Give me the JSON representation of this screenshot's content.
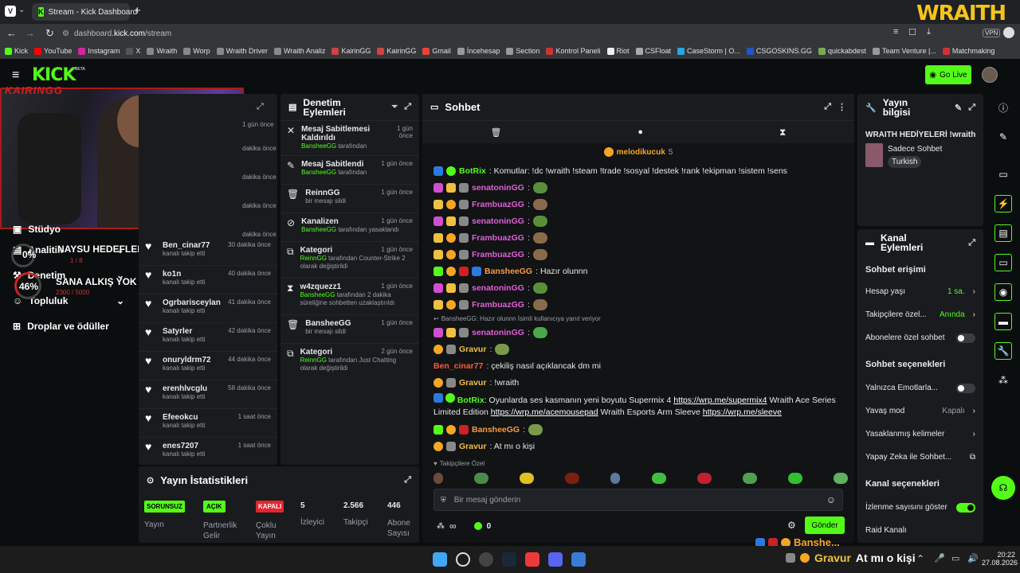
{
  "browser": {
    "tab_title": "Stream - Kick Dashboard",
    "url_prefix": "dashboard.",
    "url_domain": "kick.com",
    "url_path": "/stream",
    "new_tab": "+",
    "bookmarks": [
      "Kick",
      "YouTube",
      "Instagram",
      "X",
      "Wraith",
      "Worp",
      "Wraith Driver",
      "Wraith Analiz",
      "KairinGG",
      "KairinGG",
      "Gmail",
      "İncehesap",
      "Section",
      "Kontrol Paneli",
      "Riot",
      "CSFloat",
      "CaseStorm | O...",
      "CSGOSKINS.GG",
      "quickabdest",
      "Team Venture |...",
      "Matchmaking"
    ],
    "wraith_logo": "WRAITH",
    "vpn": "VPN"
  },
  "header": {
    "logo": "KICK",
    "beta": "BETA",
    "go_live": "Go Live"
  },
  "overlay": {
    "streamer_tag": "KAIRINGG",
    "goal1_pct": "0%",
    "goal1_label": "NAYSU HEDEFLER",
    "goal1_sub": "1 / 8",
    "goal2_pct": "46%",
    "goal2_label": "SANA ALKIŞ YOK ANCA KICK",
    "goal2_sub": "2300 / 5000"
  },
  "nav": {
    "items": [
      "Stüdyo",
      "Analitik",
      "Denetim",
      "Topluluk",
      "Droplar ve ödüller"
    ]
  },
  "activity": {
    "items": [
      {
        "time": "1 gün önce"
      },
      {
        "time": "dakika önce"
      },
      {
        "time": "dakika önce"
      },
      {
        "time": "dakika önce"
      },
      {
        "time": "dakika önce"
      },
      {
        "name": "Ben_cinar77",
        "time": "30 dakika önce",
        "action": "kanalı takip etti"
      },
      {
        "name": "ko1n",
        "time": "40 dakika önce",
        "action": "kanalı takip etti"
      },
      {
        "name": "Ogrbarisceylan",
        "time": "41 dakika önce",
        "action": "kanalı takip etti"
      },
      {
        "name": "Satyrler",
        "time": "42 dakika önce",
        "action": "kanalı takip etti"
      },
      {
        "name": "onuryldrm72",
        "time": "44 dakika önce",
        "action": "kanalı takip etti"
      },
      {
        "name": "erenhlvcglu",
        "time": "58 dakika önce",
        "action": "kanalı takip etti"
      },
      {
        "name": "Efeeokcu",
        "time": "1 saat önce",
        "action": "kanalı takip etti"
      },
      {
        "name": "enes7207",
        "time": "1 saat önce",
        "action": "kanalı takip etti"
      }
    ]
  },
  "moderation": {
    "title_line1": "Denetim",
    "title_line2": "Eylemleri",
    "items": [
      {
        "title": "Mesaj Sabitlemesi Kaldırıldı",
        "time": "1 gün önce",
        "actor": "BansheeGG",
        "rest": " tarafından"
      },
      {
        "title": "Mesaj Sabitlendi",
        "time": "1 gün önce",
        "actor": "BansheeGG",
        "rest": " tarafından"
      },
      {
        "title": "ReinnGG",
        "time": "1 gün önce",
        "actor": "",
        "rest": "bir mesajı sildi"
      },
      {
        "title": "Kanalizen",
        "time": "1 gün önce",
        "actor": "BansheeGG",
        "rest": " tarafından yasaklandı"
      },
      {
        "title": "Kategori",
        "time": "1 gün önce",
        "actor": "ReinnGG",
        "rest": " tarafından Counter-Strike 2 olarak değiştirildi"
      },
      {
        "title": "w4zquezz1",
        "time": "1 gün önce",
        "actor": "BansheeGG",
        "rest": " tarafından 2 dakika süreliğine sohbetten uzaklaştırıldı"
      },
      {
        "title": "BansheeGG",
        "time": "1 gün önce",
        "actor": "",
        "rest": "bir mesajı sildi"
      },
      {
        "title": "Kategori",
        "time": "2 gün önce",
        "actor": "ReinnGG",
        "rest": " tarafından Just Chatting olarak değiştirildi"
      }
    ]
  },
  "stats": {
    "title": "Yayın İstatistikleri",
    "cells": [
      {
        "badge": "SORUNSUZ",
        "label": "Yayın",
        "color": "#53fc18"
      },
      {
        "badge": "AÇIK",
        "label": "Partnerlik Gelir",
        "color": "#53fc18"
      },
      {
        "badge": "KAPALI",
        "label": "Çoklu Yayın",
        "color": "#e5252f"
      },
      {
        "value": "5",
        "label": "İzleyici"
      },
      {
        "value": "2.566",
        "label": "Takipçi"
      },
      {
        "value": "446",
        "label": "Abone Sayısı"
      }
    ]
  },
  "chat": {
    "title": "Sohbet",
    "pinned_user": "melodikucuk",
    "pinned_count": "5",
    "messages": [
      {
        "user": "BotRix",
        "color": "#53fc18",
        "text": ": Komutlar: !dc !wraith !steam !trade !sosyal !destek !rank !ekipman !sistem !sens",
        "emote": ""
      },
      {
        "user": "senatoninGG",
        "color": "#e05fd8",
        "text": ":",
        "emote": "#5a8f3a"
      },
      {
        "user": "FrambuazGG",
        "color": "#e05fd8",
        "text": ":",
        "emote": "#8a6a4a"
      },
      {
        "user": "senatoninGG",
        "color": "#e05fd8",
        "text": ":",
        "emote": "#5a8f3a"
      },
      {
        "user": "FrambuazGG",
        "color": "#e05fd8",
        "text": ":",
        "emote": "#8a6a4a"
      },
      {
        "user": "FrambuazGG",
        "color": "#e05fd8",
        "text": ":",
        "emote": "#8a6a4a"
      },
      {
        "user": "BansheeGG",
        "color": "#ff9a3c",
        "text": ": Hazır olunnn",
        "emote": ""
      },
      {
        "user": "senatoninGG",
        "color": "#e05fd8",
        "text": ":",
        "emote": "#5a8f3a"
      },
      {
        "user": "FrambuazGG",
        "color": "#e05fd8",
        "text": ":",
        "emote": "#8a6a4a"
      }
    ],
    "reply_note": "BansheeGG: Hazır olunnn İsimli kullanıcıya yanıt veriyor",
    "messages2": [
      {
        "user": "senatoninGG",
        "color": "#e05fd8",
        "text": ":",
        "emote": "#4aa84a"
      },
      {
        "user": "Gravur",
        "color": "#f0c040",
        "text": ":",
        "emote": "#7a9a4a"
      },
      {
        "user": "Ben_cinar77",
        "color": "#ff5a3c",
        "text": ": çekiliş nasıl açıklancak dm mi",
        "emote": ""
      },
      {
        "user": "Gravur",
        "color": "#f0c040",
        "text": ": !wraith",
        "emote": ""
      }
    ],
    "botrix2_user": "BotRix",
    "botrix2_text": ": Oyunlarda ses kasmanın yeni boyutu Supermix 4 ",
    "botrix2_link1": "https://wrp.me/supermix4",
    "botrix2_text2": " Wraith Ace Series",
    "botrix2_line2_a": "Limited Edition ",
    "botrix2_link2": "https://wrp.me/acemousepad",
    "botrix2_line2_b": " Wraith Esports Arm Sleeve ",
    "botrix2_link3": "https://wrp.me/sleeve",
    "messages3": [
      {
        "user": "BansheeGG",
        "color": "#ff9a3c",
        "text": ":",
        "emote": "#7a9a4a"
      },
      {
        "user": "Gravur",
        "color": "#f0c040",
        "text": ": At mı o kişi",
        "emote": ""
      }
    ],
    "followers_only": "Takipçilere Özel",
    "input_placeholder": "Bir mesaj gönderin",
    "points": "0",
    "infinity": "∞",
    "send": "Gönder"
  },
  "stream_info": {
    "title_line1": "Yayın",
    "title_line2": "bilgisi",
    "stream_title": "WRAITH HEDİYELERİ !wraith",
    "category": "Sadece Sohbet",
    "language": "Turkish"
  },
  "channel_actions": {
    "title_line1": "Kanal",
    "title_line2": "Eylemleri",
    "chat_access": "Sohbet erişimi",
    "account_age_label": "Hesap yaşı",
    "account_age_value": "1 sa.",
    "followers_label": "Takipçilere özel...",
    "followers_value": "Anında",
    "subs_label": "Abonelere özel sohbet",
    "chat_options": "Sohbet seçenekleri",
    "emotes_label": "Yalnızca Emotlarla...",
    "slow_label": "Yavaş mod",
    "slow_value": "Kapalı",
    "banned_words": "Yasaklanmış kelimeler",
    "ai_chat": "Yapay Zeka ile Sohbet...",
    "channel_options": "Kanal seçenekleri",
    "viewcount_label": "İzlenme sayısını göster",
    "raid": "Raid Kanalı"
  },
  "ticker": {
    "user1": "Banshe...",
    "user2": "Gravur",
    "text": "At mı o kişi"
  },
  "taskbar": {
    "time": "20:22",
    "date": "27.08.2026"
  }
}
